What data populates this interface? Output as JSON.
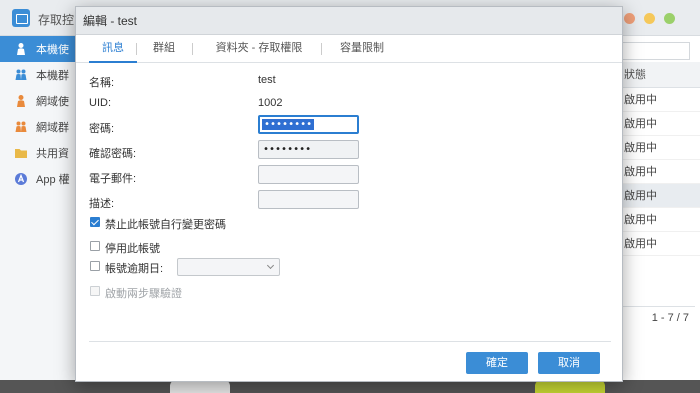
{
  "background_app": {
    "title": "存取控",
    "sidebar": [
      {
        "label": "本機使",
        "icon": "user-icon",
        "active": true
      },
      {
        "label": "本機群",
        "icon": "group-icon"
      },
      {
        "label": "網域使",
        "icon": "domain-user-icon"
      },
      {
        "label": "網域群",
        "icon": "domain-group-icon"
      },
      {
        "label": "共用資",
        "icon": "folder-icon"
      },
      {
        "label": "App 權",
        "icon": "app-icon"
      }
    ],
    "status_header": "狀態",
    "status_cells": [
      "啟用中",
      "啟用中",
      "啟用中",
      "啟用中",
      "啟用中",
      "啟用中",
      "啟用中"
    ],
    "pager": "1 - 7 / 7"
  },
  "dialog": {
    "title": "編輯 - test",
    "tabs": [
      {
        "label": "訊息",
        "active": true
      },
      {
        "label": "群組"
      },
      {
        "label": "資料夾 - 存取權限"
      },
      {
        "label": "容量限制"
      }
    ],
    "fields": {
      "name_label": "名稱:",
      "name_value": "test",
      "uid_label": "UID:",
      "uid_value": "1002",
      "password_label": "密碼:",
      "password_value": "••••••••",
      "confirm_label": "確認密碼:",
      "confirm_value": "••••••••",
      "email_label": "電子郵件:",
      "email_value": "",
      "description_label": "描述:",
      "description_value": ""
    },
    "options": {
      "disallow_change_pw": {
        "label": "禁止此帳號自行變更密碼",
        "checked": true
      },
      "disable_account": {
        "label": "停用此帳號",
        "checked": false
      },
      "expiry": {
        "label": "帳號逾期日:",
        "checked": false,
        "date": ""
      },
      "two_step": {
        "label": "啟動兩步驟驗證",
        "checked": false,
        "disabled": true
      }
    },
    "buttons": {
      "ok": "確定",
      "cancel": "取消"
    }
  },
  "colors": {
    "accent": "#3b8dd6",
    "window_close": "#f0a07a",
    "window_min": "#f5c85a",
    "window_max": "#9bd06a"
  }
}
